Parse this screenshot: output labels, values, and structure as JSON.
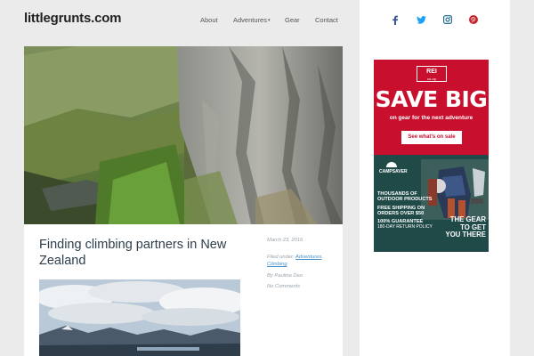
{
  "site": {
    "title": "littlegrunts.com"
  },
  "nav": {
    "items": [
      {
        "label": "About"
      },
      {
        "label": "Adventures",
        "has_dropdown": true
      },
      {
        "label": "Gear"
      },
      {
        "label": "Contact"
      }
    ]
  },
  "social": {
    "icons": [
      "facebook-icon",
      "twitter-icon",
      "instagram-icon",
      "pinterest-icon"
    ],
    "colors": {
      "facebook": "#3b5998",
      "twitter": "#1da1f2",
      "instagram": "#2a6f8f",
      "pinterest": "#cb2027"
    }
  },
  "post": {
    "title": "Finding climbing partners in New Zealand",
    "date": "March 23, 2016",
    "filed_prefix": "Filed under:",
    "categories": [
      "Adventures",
      "Climbing"
    ],
    "author": "By Paulina Dao",
    "comments": "No Comments"
  },
  "ad": {
    "rei": {
      "logo_main": "REI",
      "logo_sub": "co-op",
      "headline": "SAVE BIG",
      "sub": "on gear for the next adventure",
      "button": "See what’s on sale"
    },
    "campsaver": {
      "logo": "CAMPSAVER",
      "line1": "THOUSANDS OF OUTDOOR PRODUCTS",
      "line2": "FREE SHIPPING ON ORDERS OVER $50",
      "line3_bold": "100% GUARANTEE",
      "line3_rest": "180-DAY RETURN POLICY",
      "tagline": "THE GEAR TO GET YOU THERE"
    }
  },
  "colors": {
    "accent_link": "#4a90c9",
    "title_text": "#2d3e4b",
    "rei_red": "#c8102e",
    "campsaver_green": "#1f4a48"
  }
}
